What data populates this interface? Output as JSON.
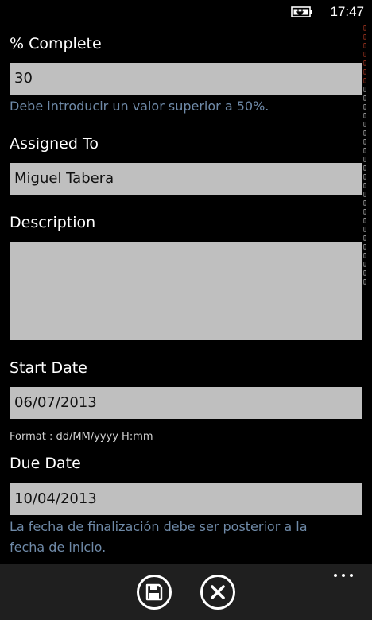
{
  "status_bar": {
    "time": "17:47",
    "battery_icon": "battery-charging-icon"
  },
  "form": {
    "percent_complete": {
      "label": "% Complete",
      "value": "30",
      "error": "Debe introducir un valor superior a 50%."
    },
    "assigned_to": {
      "label": "Assigned To",
      "value": "Miguel Tabera"
    },
    "description": {
      "label": "Description",
      "value": ""
    },
    "start_date": {
      "label": "Start Date",
      "value": "06/07/2013",
      "hint": "Format : dd/MM/yyyy H:mm"
    },
    "due_date": {
      "label": "Due Date",
      "value": "10/04/2013",
      "error_line1": "La fecha de finalización debe ser posterior a la",
      "error_line2": "fecha de inicio."
    }
  },
  "app_bar": {
    "save_icon": "save-icon",
    "cancel_icon": "close-icon",
    "more_icon": "more-ellipsis-icon"
  },
  "colors": {
    "background": "#000000",
    "field_background": "#bfbfbf",
    "error_text": "#6f8aa8",
    "app_bar": "#1f1f1f",
    "accent_red": "#d0442a"
  }
}
